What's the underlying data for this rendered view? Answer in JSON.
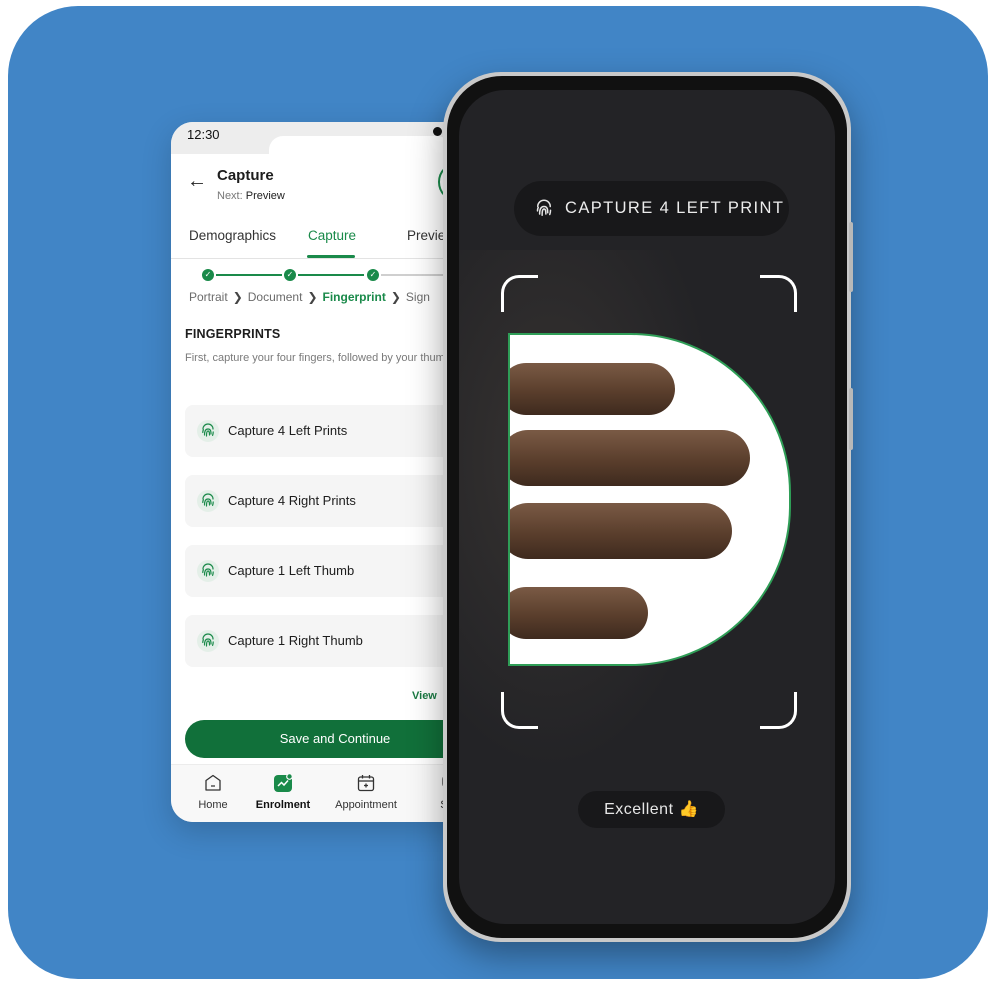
{
  "colors": {
    "background_card": "#4185c6",
    "accent_green": "#1a8a4a",
    "button_green": "#11703a",
    "camera_bg": "#232326"
  },
  "app_screen": {
    "status_time": "12:30",
    "header": {
      "title": "Capture",
      "next_label": "Next:",
      "next_value": "Preview"
    },
    "tabs": [
      "Demographics",
      "Capture",
      "Previe"
    ],
    "active_tab": "Capture",
    "breadcrumb": [
      "Portrait",
      "Document",
      "Fingerprint",
      "Sign"
    ],
    "breadcrumb_current": "Fingerprint",
    "section_title": "FINGERPRINTS",
    "section_desc": "First, capture your four fingers, followed by your thumb.",
    "capture_items": [
      {
        "label": "Capture 4 Left Prints",
        "icon": "fingerprint-icon"
      },
      {
        "label": "Capture 4 Right Prints",
        "icon": "fingerprint-icon"
      },
      {
        "label": "Capture 1 Left Thumb",
        "icon": "fingerprint-icon"
      },
      {
        "label": "Capture 1 Right Thumb",
        "icon": "fingerprint-icon"
      }
    ],
    "view_link": "View",
    "save_button": "Save and Continue",
    "bottom_nav": [
      {
        "label": "Home",
        "icon": "home-icon"
      },
      {
        "label": "Enrolment",
        "icon": "enrolment-icon",
        "active": true
      },
      {
        "label": "Appointment",
        "icon": "calendar-icon"
      },
      {
        "label": "Sup",
        "icon": "support-icon"
      }
    ]
  },
  "camera_screen": {
    "capture_label": "CAPTURE 4 LEFT PRINT",
    "capture_icon": "fingerprint-icon",
    "quality_label": "Excellent",
    "quality_icon": "thumbs-up-icon",
    "quality_emoji": "👍"
  }
}
